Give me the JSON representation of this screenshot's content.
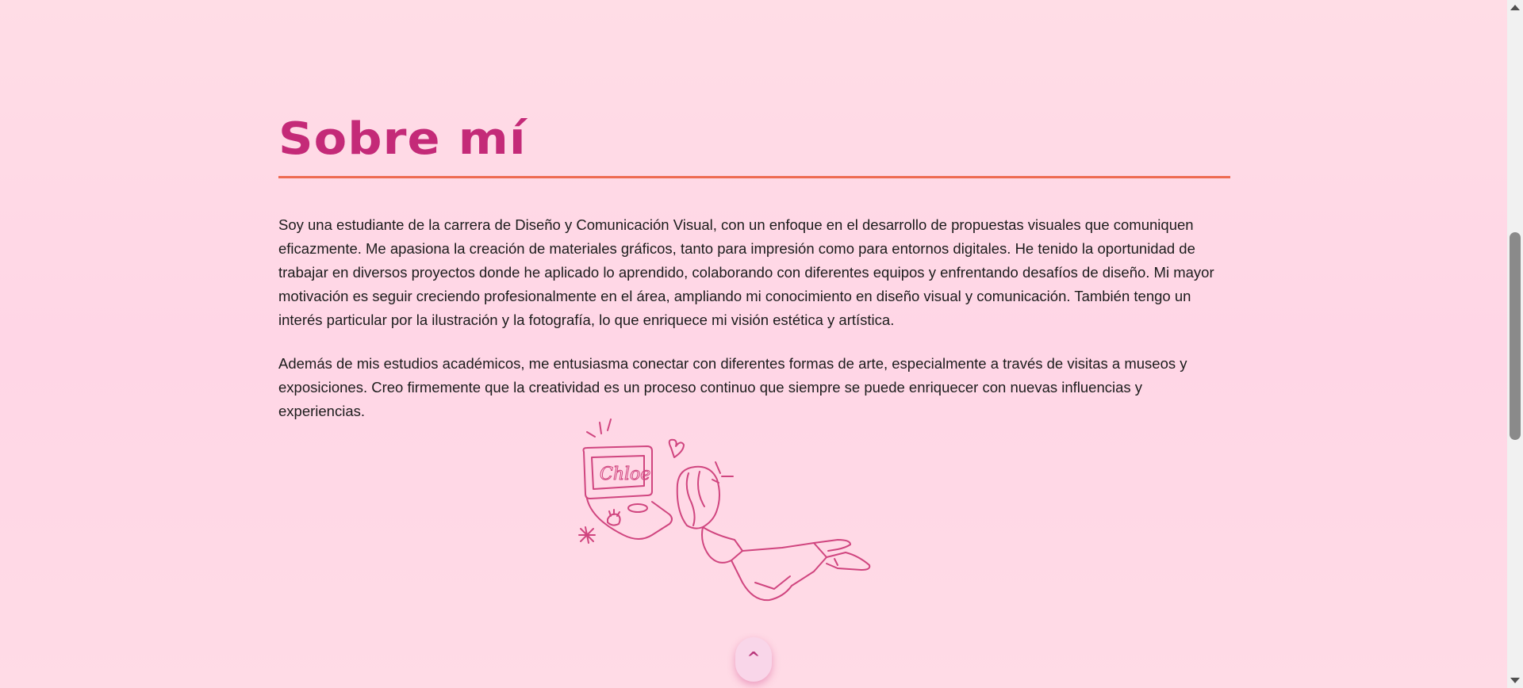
{
  "about": {
    "title": "Sobre mí",
    "paragraphs": [
      "Soy una estudiante de la carrera de Diseño y Comunicación Visual, con un enfoque en el desarrollo de propuestas visuales que comuniquen eficazmente. Me apasiona la creación de materiales gráficos, tanto para impresión como para entornos digitales. He tenido la oportunidad de trabajar en diversos proyectos donde he aplicado lo aprendido, colaborando con diferentes equipos y enfrentando desafíos de diseño. Mi mayor motivación es seguir creciendo profesionalmente en el área, ampliando mi conocimiento en diseño visual y comunicación. También tengo un interés particular por la ilustración y la fotografía, lo que enriquece mi visión estética y artística.",
      "Además de mis estudios académicos, me entusiasma conectar con diferentes formas de arte, especialmente a través de visitas a museos y exposiciones. Creo firmemente que la creatividad es un proceso continuo que siempre se puede enriquecer con nuevas influencias y experiencias."
    ],
    "illustration": {
      "icon": "flying-girl-laptop-sketch",
      "screen_text": "Chloe"
    }
  },
  "scroll_top_button": {
    "label": "^"
  },
  "colors": {
    "title": "#c42a78",
    "rule": "#ee6b52",
    "illustration_stroke": "#d0457f",
    "background": "#ffd9e6"
  }
}
